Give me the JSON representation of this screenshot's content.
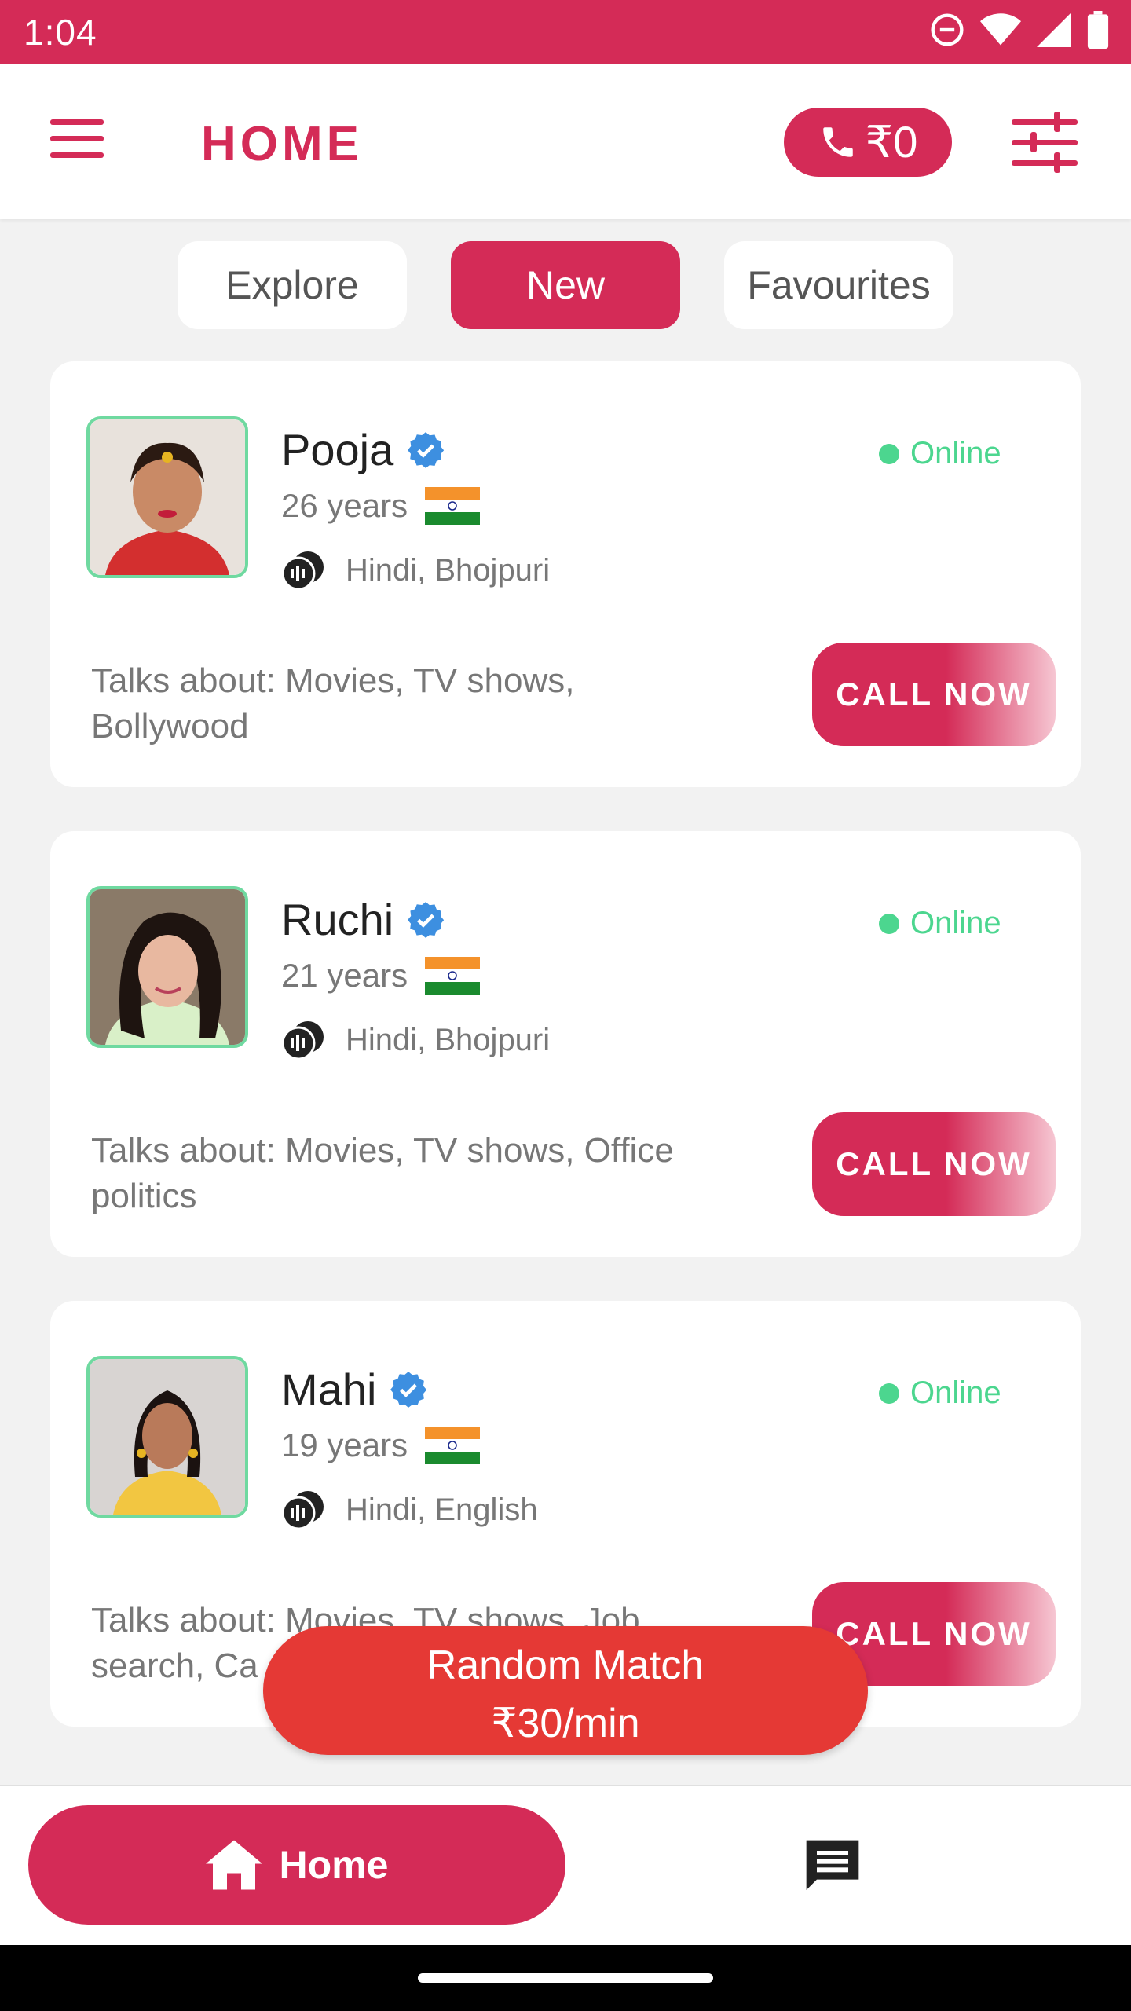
{
  "status_bar": {
    "time": "1:04"
  },
  "app_bar": {
    "title": "HOME",
    "wallet": "₹0"
  },
  "tabs": [
    {
      "label": "Explore",
      "active": false
    },
    {
      "label": "New",
      "active": true
    },
    {
      "label": "Favourites",
      "active": false
    }
  ],
  "profiles": [
    {
      "name": "Pooja",
      "age": "26 years",
      "languages": "Hindi, Bhojpuri",
      "status": "Online",
      "talks": "Talks about: Movies, TV shows, Bollywood",
      "cta": "CALL NOW"
    },
    {
      "name": "Ruchi",
      "age": "21 years",
      "languages": "Hindi, Bhojpuri",
      "status": "Online",
      "talks": "Talks about: Movies, TV shows, Office politics",
      "cta": "CALL NOW"
    },
    {
      "name": "Mahi",
      "age": "19 years",
      "languages": "Hindi, English",
      "status": "Online",
      "talks": "Talks about: Movies, TV shows, Job search, Ca",
      "cta": "CALL NOW"
    }
  ],
  "random_match": {
    "line1": "Random Match",
    "line2": "₹30/min"
  },
  "bottom_nav": {
    "home_label": "Home"
  },
  "colors": {
    "brand": "#d42b57",
    "online": "#4cd68f",
    "random": "#e53935"
  },
  "icons": [
    "menu-icon",
    "phone-icon",
    "filter-icon",
    "verified-icon",
    "india-flag-icon",
    "voice-chat-icon",
    "home-icon",
    "chat-icon"
  ]
}
